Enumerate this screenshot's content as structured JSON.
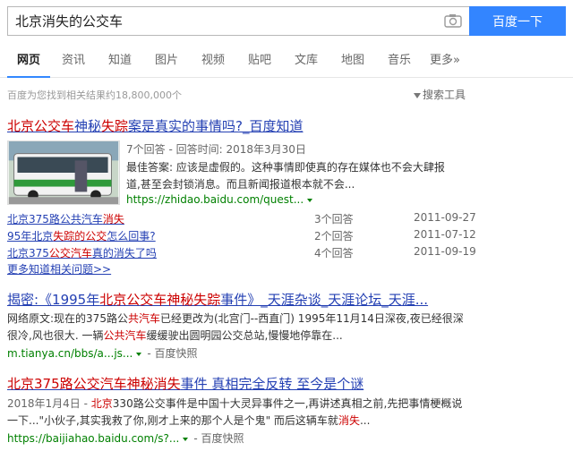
{
  "search": {
    "query": "北京消失的公交车",
    "button_label": "百度一下"
  },
  "tabs": [
    {
      "label": "网页",
      "active": true
    },
    {
      "label": "资讯"
    },
    {
      "label": "知道"
    },
    {
      "label": "图片"
    },
    {
      "label": "视频"
    },
    {
      "label": "贴吧"
    },
    {
      "label": "文库"
    },
    {
      "label": "地图"
    },
    {
      "label": "音乐"
    },
    {
      "label": "更多»"
    }
  ],
  "stats_text": "百度为您找到相关结果约18,800,000个",
  "tools_label": "搜索工具",
  "results": {
    "r1": {
      "title_parts": [
        "北京公交车",
        "神秘",
        "失踪",
        "案是真实的事情吗?_百度知道"
      ],
      "meta": "7个回答 - 回答时间: 2018年3月30日",
      "snippet_line1": "最佳答案: 应该是虚假的。这种事情即使真的存在媒体也不会大肆报",
      "snippet_line2": "道,甚至会封锁消息。而且新闻报道根本就不会...",
      "url": "https://zhidao.baidu.com/quest...",
      "sub_questions": [
        {
          "pre": "北京375路公共汽车",
          "em": "消失",
          "post": "",
          "count": "3个回答",
          "date": "2011-09-27"
        },
        {
          "pre": "95年北京",
          "em": "失踪的公交",
          "post": "怎么回事?",
          "count": "2个回答",
          "date": "2011-07-12"
        },
        {
          "pre": "北京375",
          "em": "公交汽车",
          "post": "真的消失了吗",
          "count": "4个回答",
          "date": "2011-09-19"
        }
      ],
      "more_label": "更多知道相关问题>>"
    },
    "r2": {
      "title_parts": [
        "揭密:《1995年",
        "北京公交车神秘失踪",
        "事件》_天涯杂谈_天涯论坛_天涯..."
      ],
      "snippet_line1_pre": "网络原文:现在的375路公",
      "snippet_line1_em": "共汽车",
      "snippet_line1_post": "已经更改为(北宫门--西直门) 1995年11月14日深夜,夜已经很深",
      "snippet_line2_pre": "很冷,风也很大. 一辆",
      "snippet_line2_em": "公共汽车",
      "snippet_line2_post": "缓缓驶出圆明园公交总站,慢慢地停靠在...",
      "url": "m.tianya.cn/bbs/a...js...",
      "cache": "百度快照"
    },
    "r3": {
      "title_parts": [
        "北京375路公交汽车",
        "神秘消失",
        "事件 真相完全反转 至今是个谜"
      ],
      "snippet_line1_date": "2018年1月4日 - ",
      "snippet_line1_em": "北京",
      "snippet_line1_post": "330路公交事件是中国十大灵异事件之一,再讲述真相之前,先把事情梗概说",
      "snippet_line2_pre": "一下...\"小伙子,其实我救了你,刚才上来的那个人是个鬼\" 而后这辆车就",
      "snippet_line2_em": "消失",
      "snippet_line2_post": "...",
      "url": "https://baijiahao.baidu.com/s?...",
      "cache": "百度快照"
    }
  },
  "colors": {
    "link": "#2440b3",
    "highlight": "#cc0000",
    "url": "#008000",
    "button": "#3385ff"
  }
}
